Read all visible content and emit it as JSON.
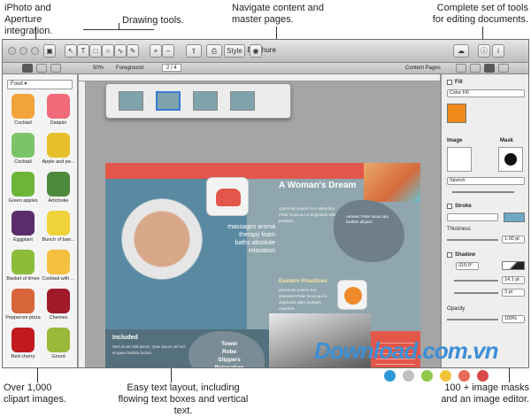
{
  "callouts": {
    "iphoto": "iPhoto and Aperture integration.",
    "drawing": "Drawing tools.",
    "navigate": "Navigate content and master pages.",
    "tools": "Complete set of tools for editing documents.",
    "clipart": "Over 1,000 clipart images.",
    "textlayout": "Easy text layout, including flowing text boxes and vertical text.",
    "masks": "100 + image masks and an image editor."
  },
  "window": {
    "title": "Spa Brochure",
    "zoom": "50%",
    "layer": "Foreground",
    "page_indicator": "2 / 4",
    "content_pages": "Content Pages"
  },
  "sidebar": {
    "category": "Food",
    "clips": [
      {
        "label": "Cocktail",
        "color": "#f2a33a"
      },
      {
        "label": "Daiquiri",
        "color": "#f06a7a"
      },
      {
        "label": "Cocktail",
        "color": "#7cc46a"
      },
      {
        "label": "Apple and pe...",
        "color": "#e6c02a"
      },
      {
        "label": "Green apples",
        "color": "#6cb43a"
      },
      {
        "label": "Artichoke",
        "color": "#4d8a3c"
      },
      {
        "label": "Eggplant",
        "color": "#5a2d6a"
      },
      {
        "label": "Bunch of ban...",
        "color": "#f0d23a"
      },
      {
        "label": "Basket of limes",
        "color": "#8cbc3a"
      },
      {
        "label": "Cocktail with ...",
        "color": "#f5c040"
      },
      {
        "label": "Pepperoni pizza",
        "color": "#d8643a"
      },
      {
        "label": "Cherries",
        "color": "#a01a2a"
      },
      {
        "label": "Red cherry",
        "color": "#c01a20"
      },
      {
        "label": "Gourd",
        "color": "#9ab83a"
      }
    ]
  },
  "brochure": {
    "heading": "A Woman's Dream",
    "quote": "massages aroma therapy foam baths absolute relaxation",
    "intro": "Quomodo potens hoc attendant Peter locus qui in dogmasis aliter probaris.",
    "section_title": "Eastern Practices",
    "section_text": "Quomodo potens hoc attendant Peter locus qui in dogmasis aliter probaris expertior.",
    "included_title": "Included",
    "included_text": "Sed at vel nisit ipsum. Quis ipsum vel nisl et quae facilisis luctus.",
    "leaf_lines": [
      "Towel",
      "Robe",
      "Slippers",
      "Relaxation"
    ],
    "side_text": "Aenean Peter locus spa facilisis aliquet."
  },
  "inspector": {
    "fill_label": "Fill",
    "fill_type": "Color Fill",
    "fill_color": "#f08a1a",
    "image_label": "Image",
    "mask_label": "Mask",
    "stretch": "Stretch",
    "stroke_label": "Stroke",
    "thickness_label": "Thickness",
    "thickness_value": "1.00 pt",
    "shadow_label": "Shadow",
    "shadow_angle": "315.0°",
    "shadow_offset": "14.1 pt",
    "shadow_blur": "3 pt",
    "opacity_label": "Opacity",
    "opacity_value": "100%"
  },
  "toolbar": {
    "style": "Style"
  },
  "watermark": "Download.com.vn",
  "colors": {
    "coral": "#e2574a",
    "teal_page": "#8fa6ae",
    "leaf": "#6e7e8a",
    "dots": [
      "#2f98d9",
      "#c0c0c0",
      "#8fc84a",
      "#f2c43a",
      "#e86a5a",
      "#d84a4a"
    ]
  }
}
